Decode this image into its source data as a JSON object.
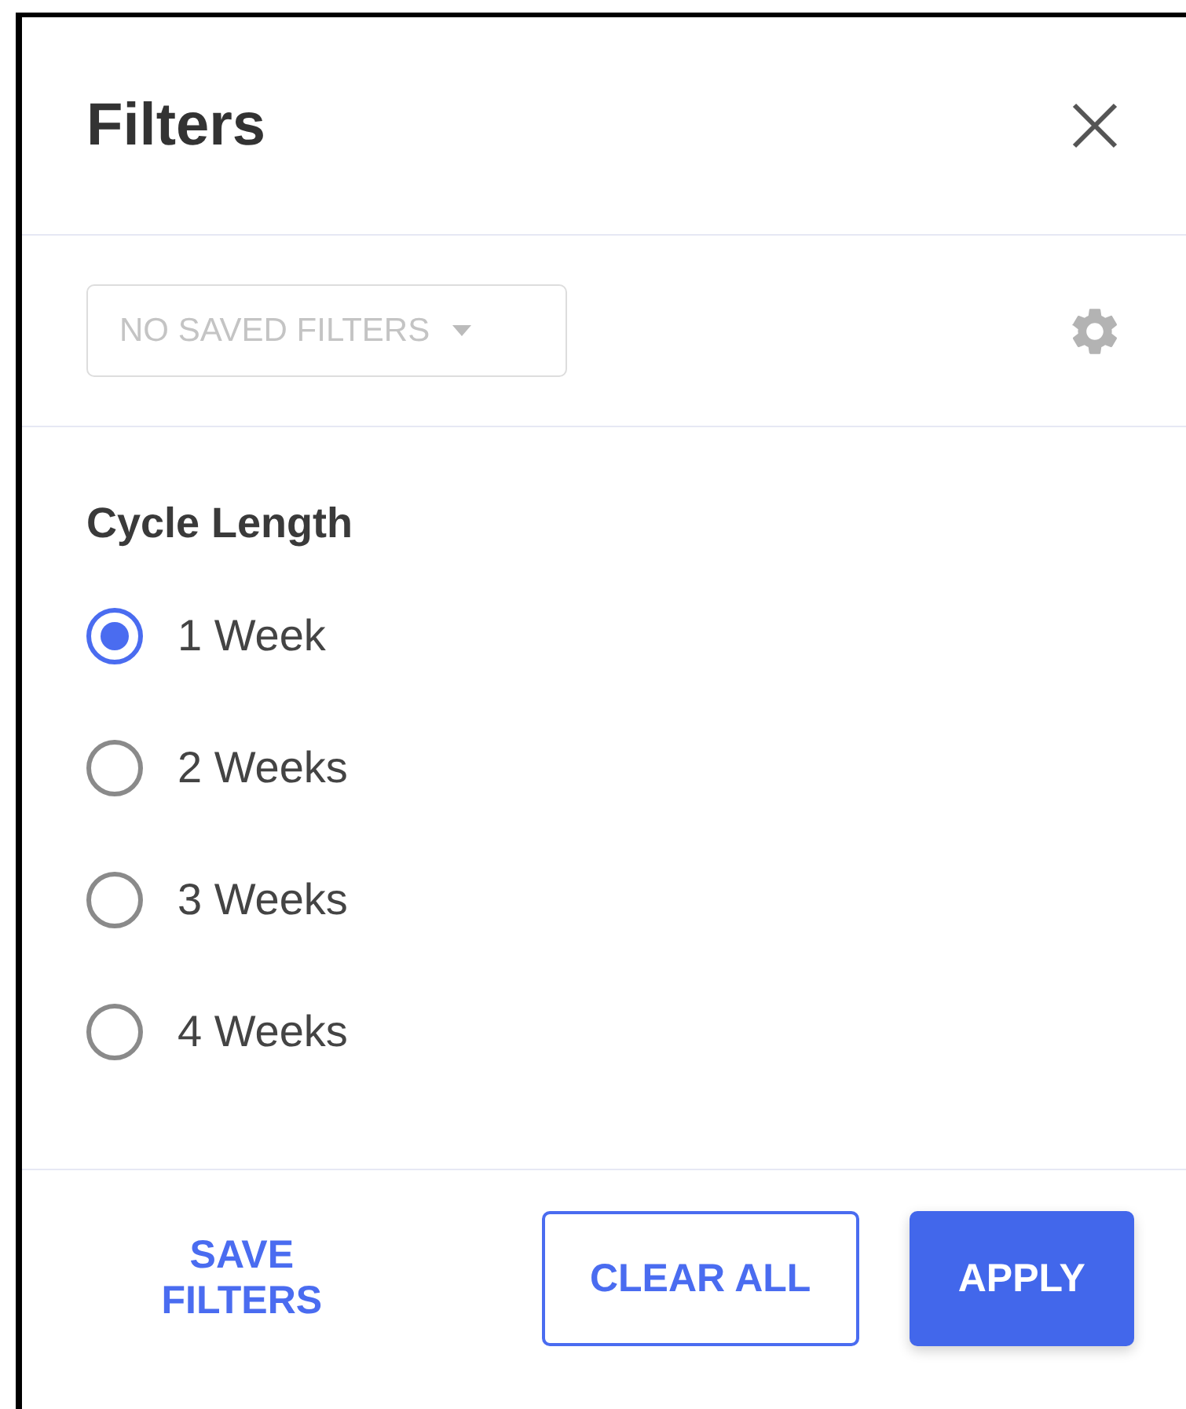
{
  "title": "Filters",
  "saved_filters": {
    "placeholder": "NO SAVED FILTERS",
    "disabled": true
  },
  "section": {
    "title": "Cycle Length",
    "options": [
      {
        "label": "1 Week",
        "selected": true
      },
      {
        "label": "2 Weeks",
        "selected": false
      },
      {
        "label": "3 Weeks",
        "selected": false
      },
      {
        "label": "4 Weeks",
        "selected": false
      }
    ]
  },
  "buttons": [
    {
      "label": "SAVE FILTERS",
      "kind": "text"
    },
    {
      "label": "CLEAR ALL",
      "kind": "outlined"
    },
    {
      "label": "APPLY",
      "kind": "filled"
    }
  ]
}
